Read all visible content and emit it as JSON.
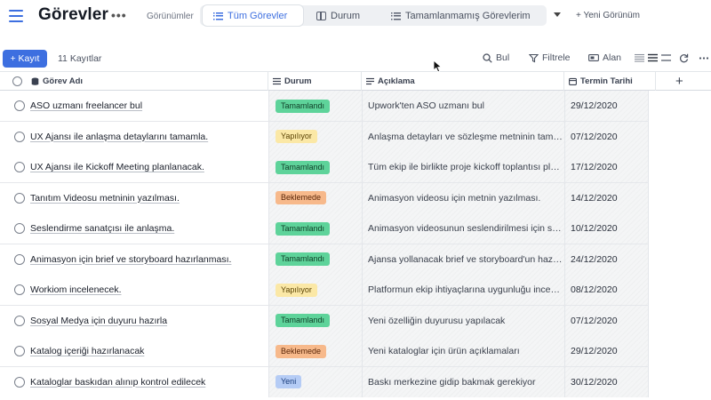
{
  "header": {
    "title": "Görevler",
    "more": "•••",
    "views_label": "Görünümler",
    "tabs": [
      {
        "label": "Tüm Görevler",
        "active": true,
        "icon": "list-icon"
      },
      {
        "label": "Durum",
        "active": false,
        "icon": "board-icon"
      },
      {
        "label": "Tamamlanmamış Görevlerim",
        "active": false,
        "icon": "list-icon"
      }
    ],
    "new_view": "+   Yeni Görünüm"
  },
  "toolbar": {
    "add_label": "+ Kayıt",
    "record_count": "11 Kayıtlar",
    "find": "Bul",
    "filter": "Filtrele",
    "fields": "Alan"
  },
  "columns": {
    "name": "Görev Adı",
    "status": "Durum",
    "description": "Açıklama",
    "due": "Termin Tarihi",
    "add": "+"
  },
  "rows": [
    {
      "name": "ASO uzmanı freelancer bul",
      "status": "Tamamlandı",
      "status_type": "done",
      "description": "Upwork'ten ASO uzmanı bul",
      "due": "29/12/2020"
    },
    {
      "name": "UX Ajansı ile anlaşma detaylarını tamamla.",
      "status": "Yapılıyor",
      "status_type": "progress",
      "description": "Anlaşma detayları ve sözleşme metninin tam…",
      "due": "07/12/2020"
    },
    {
      "name": "UX Ajansı ile Kickoff Meeting planlanacak.",
      "status": "Tamamlandı",
      "status_type": "done",
      "description": "Tüm ekip ile birlikte proje kickoff toplantısı pl…",
      "due": "17/12/2020"
    },
    {
      "name": "Tanıtım Videosu metninin yazılması.",
      "status": "Beklemede",
      "status_type": "wait",
      "description": "Animasyon videosu için metnin yazılması.",
      "due": "14/12/2020"
    },
    {
      "name": "Seslendirme sanatçısı ile anlaşma.",
      "status": "Tamamlandı",
      "status_type": "done",
      "description": "Animasyon videosunun seslendirilmesi için s…",
      "due": "10/12/2020"
    },
    {
      "name": "Animasyon için brief ve storyboard hazırlanması.",
      "status": "Tamamlandı",
      "status_type": "done",
      "description": "Ajansa yollanacak brief ve storyboard'un haz…",
      "due": "24/12/2020"
    },
    {
      "name": "Workiom incelenecek.",
      "status": "Yapılıyor",
      "status_type": "progress",
      "description": "Platformun ekip ihtiyaçlarına uygunluğu ince…",
      "due": "08/12/2020"
    },
    {
      "name": "Sosyal Medya için duyuru hazırla",
      "status": "Tamamlandı",
      "status_type": "done",
      "description": "Yeni özelliğin duyurusu yapılacak",
      "due": "07/12/2020"
    },
    {
      "name": "Katalog içeriği hazırlanacak",
      "status": "Beklemede",
      "status_type": "wait",
      "description": "Yeni kataloglar için ürün açıklamaları",
      "due": "29/12/2020"
    },
    {
      "name": "Kataloglar baskıdan alınıp kontrol edilecek",
      "status": "Yeni",
      "status_type": "new",
      "description": "Baskı merkezine gidip bakmak gerekiyor",
      "due": "30/12/2020"
    }
  ],
  "colors": {
    "accent": "#3d6fe0",
    "done": "#5ed39a",
    "progress": "#fbe8a6",
    "wait": "#f7b98b",
    "new": "#b5ccf5"
  }
}
